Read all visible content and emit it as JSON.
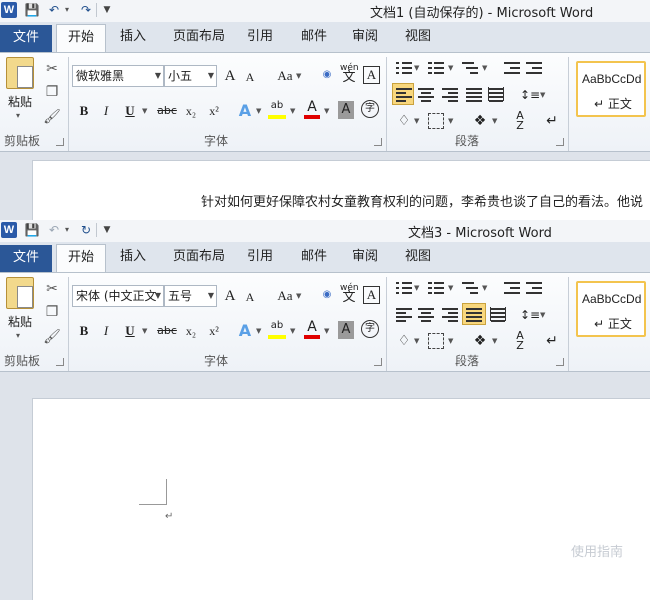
{
  "windows": [
    {
      "title": "文档1 (自动保存的) - Microsoft Word",
      "logo": "W",
      "tabs": [
        "文件",
        "开始",
        "插入",
        "页面布局",
        "引用",
        "邮件",
        "审阅",
        "视图"
      ],
      "font_name": "微软雅黑",
      "font_size": "小五",
      "align_active": "left",
      "doc_text": "针对如何更好保障农村女童教育权利的问题，李希贵也谈了自己的看法。他说"
    },
    {
      "title": "文档3 - Microsoft Word",
      "logo": "W",
      "tabs": [
        "文件",
        "开始",
        "插入",
        "页面布局",
        "引用",
        "邮件",
        "审阅",
        "视图"
      ],
      "font_name": "宋体 (中文正文",
      "font_size": "五号",
      "align_active": "justify",
      "doc_text": ""
    }
  ],
  "ribbon": {
    "paste_label": "粘贴",
    "group_clipboard": "剪贴板",
    "group_font": "字体",
    "group_paragraph": "段落",
    "style_sample": "AaBbCcDd",
    "style_name": "↵ 正文",
    "btn_grow": "A",
    "btn_shrink": "A",
    "btn_case": "Aa",
    "btn_bold": "B",
    "btn_italic": "I",
    "btn_underline": "U",
    "btn_strike": "abc",
    "btn_sub": "x₂",
    "btn_sup": "x²",
    "btn_phonetic": "wén",
    "btn_phonetic_char": "文",
    "btn_border_char": "A",
    "btn_shade_char": "A",
    "btn_enclose": "字",
    "btn_highlight": "ab",
    "btn_color": "A"
  },
  "doc2": {
    "para_mark": "↵"
  },
  "watermark": "  使用指南",
  "colors": {
    "file_tab": "#2b5797",
    "style_border": "#f3c44e",
    "highlight": "#ffff00",
    "font_color": "#e00000",
    "active_align": "#f8d77d"
  },
  "icons": [
    "save-icon",
    "undo-icon",
    "redo-icon",
    "paste-icon",
    "cut-icon",
    "copy-icon",
    "format-painter-icon",
    "bullets-icon",
    "numbering-icon",
    "multilevel-list-icon",
    "decrease-indent-icon",
    "increase-indent-icon",
    "align-left-icon",
    "align-center-icon",
    "align-right-icon",
    "justify-icon",
    "distributed-icon",
    "line-spacing-icon",
    "shading-icon",
    "borders-icon",
    "chinese-layout-icon",
    "sort-icon",
    "show-marks-icon"
  ]
}
